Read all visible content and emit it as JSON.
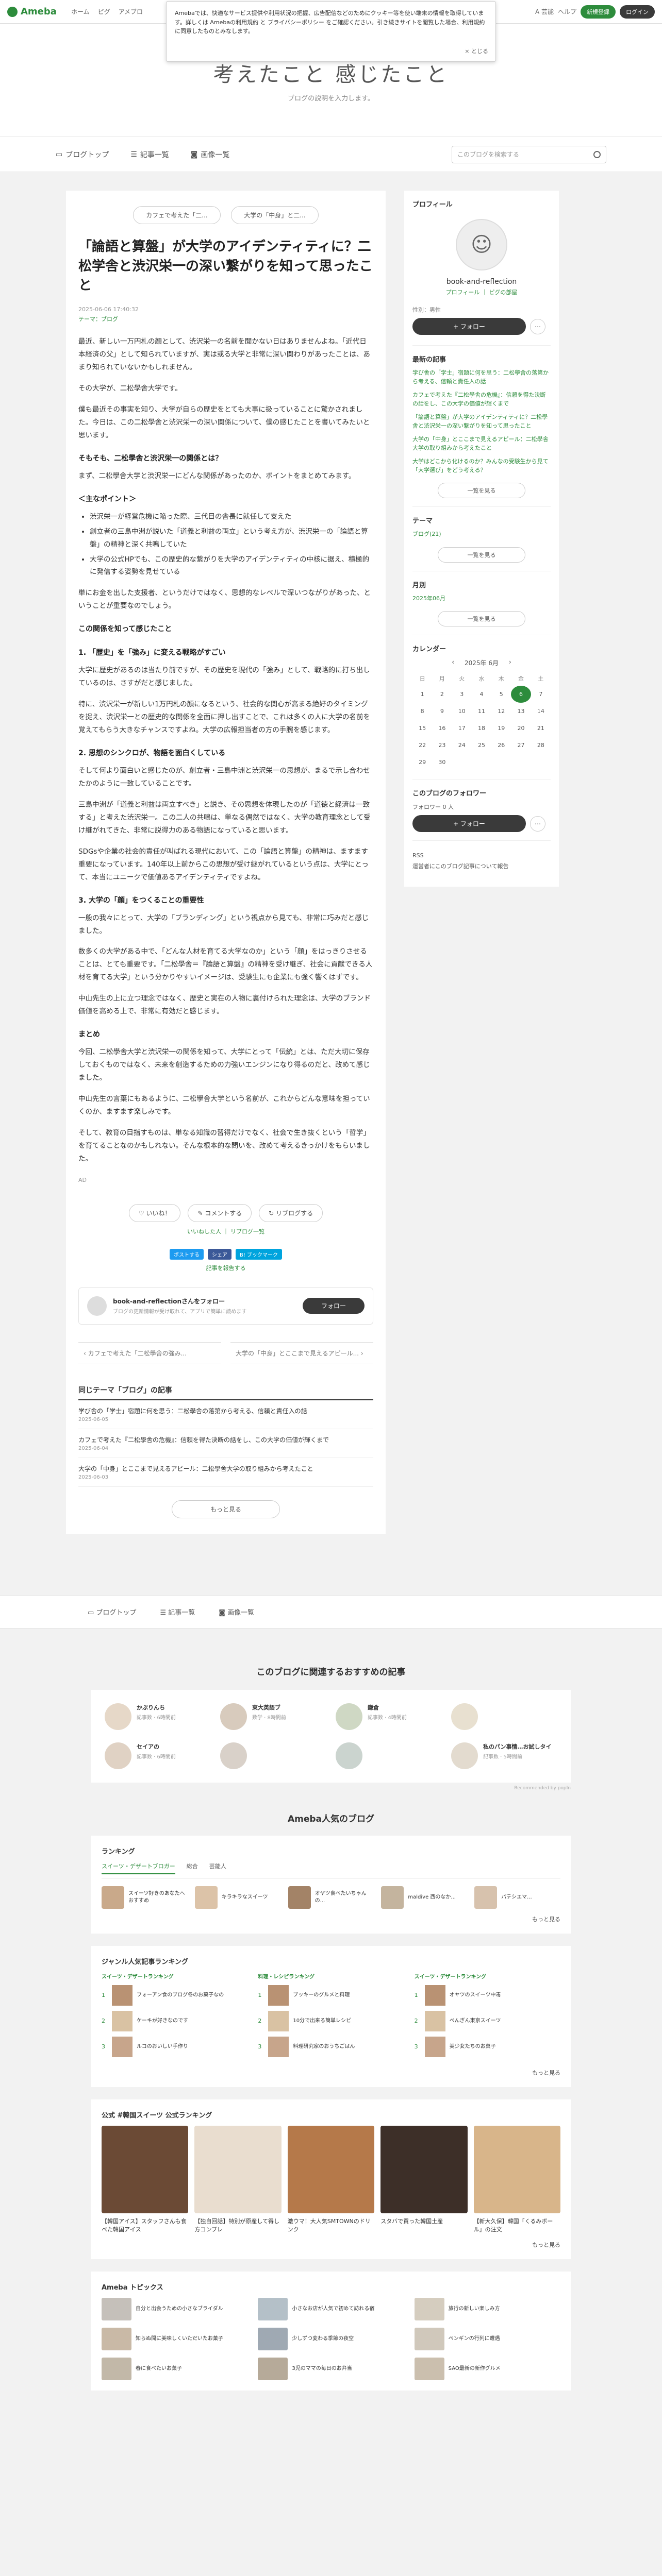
{
  "topnav": {
    "logo": "Ameba",
    "links": [
      "ホーム",
      "ピグ",
      "アメブロ"
    ],
    "right": [
      "A 芸能",
      "ヘルプ"
    ],
    "signup": "新規登録",
    "login": "ログイン"
  },
  "cookie": {
    "text": "Amebaでは、快適なサービス提供や利用状況の把握、広告配信などのためにクッキー等を使い端末の情報を取得しています。詳しくは Amebaの利用規約 と プライバシーポリシー をご確認ください。引き続きサイトを閲覧した場合、利用規約に同意したものとみなします。",
    "close": "× とじる"
  },
  "blog": {
    "title": "考えたこと  感じたこと",
    "description": "ブログの説明を入力します。"
  },
  "subnav": {
    "tabs": [
      "ブログトップ",
      "記事一覧",
      "画像一覧"
    ],
    "search_placeholder": "このブログを検索する"
  },
  "article": {
    "prev_pill": "カフェで考えた「二...",
    "next_pill": "大学の「中身」と二...",
    "title": "「論語と算盤」が大学のアイデンティティに？二松学舎と渋沢栄一の深い繋がりを知って思ったこと",
    "date": "2025-06-06 17:40:32",
    "theme": "テーマ：ブログ",
    "p1": "最近、新しい一万円札の顔として、渋沢栄一の名前を聞かない日はありませんよね。「近代日本経済の父」として知られていますが、実は或る大学と非常に深い関わりがあったことは、あまり知られていないかもしれません。",
    "p2": "その大学が、二松學舎大学です。",
    "p3": "僕も最近その事実を知り、大学が自らの歴史をとても大事に扱っていることに驚かされました。今日は、この二松學舎と渋沢栄一の深い関係について、僕の感じたことを書いてみたいと思います。",
    "h1": "そもそも、二松學舎と渋沢栄一の関係とは？",
    "p4": "まず、二松學舎大学と渋沢栄一にどんな関係があったのか、ポイントをまとめてみます。",
    "h2": "＜主なポイント＞",
    "points": [
      "渋沢栄一が経営危機に陥った際、三代目の舎長に就任して支えた",
      "創立者の三島中洲が説いた「道義と利益の両立」という考え方が、渋沢栄一の「論語と算盤」の精神と深く共鳴していた",
      "大学の公式HPでも、この歴史的な繋がりを大学のアイデンティティの中核に据え、積極的に発信する姿勢を見せている"
    ],
    "p5": "単にお金を出した支援者、というだけではなく、思想的なレベルで深いつながりがあった、ということが重要なのでしょう。",
    "h3": "この関係を知って感じたこと",
    "h4": "1. 「歴史」を「強み」に変える戦略がすごい",
    "p6": "大学に歴史があるのは当たり前ですが、その歴史を現代の「強み」として、戦略的に打ち出しているのは、さすがだと感じました。",
    "p7": "特に、渋沢栄一が新しい1万円札の顔になるという、社会的な関心が高まる絶好のタイミングを捉え、渋沢栄一との歴史的な関係を全面に押し出すことで、これは多くの人に大学の名前を覚えてもらう大きなチャンスですよね。大学の広報担当者の方の手腕を感じます。",
    "h5": "2. 思想のシンクロが、物語を面白くしている",
    "p8": "そして何より面白いと感じたのが、創立者・三島中洲と渋沢栄一の思想が、まるで示し合わせたかのように一致していることです。",
    "p9": "三島中洲が「道義と利益は両立すべき」と説き、その思想を体現したのが「道徳と経済は一致する」と考えた渋沢栄一。この二人の共鳴は、単なる偶然ではなく、大学の教育理念として受け継がれてきた、非常に説得力のある物語になっていると思います。",
    "p10": "SDGsや企業の社会的責任が叫ばれる現代において、この「論語と算盤」の精神は、ますます重要になっています。140年以上前からこの思想が受け継がれているという点は、大学にとって、本当にユニークで価値あるアイデンティティですよね。",
    "h6": "3. 大学の「顔」をつくることの重要性",
    "p11": "一般の我々にとって、大学の「ブランディング」という視点から見ても、非常に巧みだと感じました。",
    "p12": "数多くの大学がある中で、「どんな人材を育てる大学なのか」という「顔」をはっきりさせることは、とても重要です。「二松學舎＝『論語と算盤』の精神を受け継ぎ、社会に貢献できる人材を育てる大学」という分かりやすいイメージは、受験生にも企業にも強く響くはずです。",
    "p13": "中山先生の上に立つ理念ではなく、歴史と実在の人物に裏付けられた理念は、大学のブランド価値を高める上で、非常に有効だと感じます。",
    "h7": "まとめ",
    "p14": "今回、二松學舎大学と渋沢栄一の関係を知って、大学にとって「伝統」とは、ただ大切に保存しておくものではなく、未来を創造するための力強いエンジンになり得るのだと、改めて感じました。",
    "p15": "中山先生の言葉にもあるように、二松學舎大学という名前が、これからどんな意味を担っていくのか、ますます楽しみです。",
    "p16": "そして、教育の目指すものは、単なる知識の習得だけでなく、社会で生き抜くという「哲学」を育てることなのかもしれない。そんな根本的な問いを、改めて考えるきっかけをもらいました。",
    "author_line": "AD"
  },
  "actions": {
    "like": "いいね！",
    "comment": "コメントする",
    "reblog": "リブログする",
    "like_users": "いいねした人 ｜ リブログ一覧",
    "share": [
      "ポストする",
      "シェア",
      "B! ブックマーク"
    ],
    "report": "記事を報告する"
  },
  "followcard": {
    "name": "book-and-reflectionさんをフォロー",
    "sub": "ブログの更新情報が受け取れて、アプリで簡単に読めます",
    "button": "フォロー"
  },
  "prevnext": {
    "prev": "カフェで考えた「二松學舎の強み...",
    "next": "大学の「中身」とここまで見えるアピール..."
  },
  "related": {
    "title": "同じテーマ「ブログ」の記事",
    "items": [
      {
        "t": "学び舎の「学士」宿題に何を思う：二松學舎の落第から考える、信頼と責任入の話",
        "d": "2025-06-05"
      },
      {
        "t": "カフェで考えた『二松學舎の危機』：信頼を得た決断の話をし、この大学の価値が輝くまで",
        "d": "2025-06-04"
      },
      {
        "t": "大学の「中身」とここまで見えるアピール：二松學舎大学の取り組みから考えたこと",
        "d": "2025-06-03"
      }
    ],
    "more": "もっと見る"
  },
  "sidebar": {
    "profile_h": "プロフィール",
    "name": "book-and-reflection",
    "links": "プロフィール ｜ ピグの部屋",
    "status": "性別：男性",
    "follow": "+ フォロー",
    "recent_h": "最新の記事",
    "recent": [
      "学び舎の「学士」宿題に何を思う：二松學舎の落第から考える、信頼と責任入の話",
      "カフェで考えた『二松學舎の危機』：信頼を得た決断の話をし、この大学の価値が輝くまで",
      "「論語と算盤」が大学のアイデンティティに？二松學舎と渋沢栄一の深い繋がりを知って思ったこと",
      "大学の「中身」とここまで見えるアピール：二松學舎大学の取り組みから考えたこと",
      "大学はどこから化けるのか？みんなの受験生から見て「大学選び」をどう考える？"
    ],
    "recent_btn": "一覧を見る",
    "theme_h": "テーマ",
    "theme_item": "ブログ(21)",
    "theme_btn": "一覧を見る",
    "month_h": "月別",
    "month_item": "2025年06月",
    "month_btn": "一覧を見る",
    "cal_h": "カレンダー",
    "cal_month": "2025年 6月",
    "cal_days": [
      "日",
      "月",
      "火",
      "水",
      "木",
      "金",
      "土"
    ],
    "followers_h": "このブログのフォロワー",
    "followers": "フォロワー 0 人",
    "follow2": "+ フォロー",
    "rss": "RSS",
    "report": "運営者にこのブログ記事について報告"
  },
  "recommend": {
    "title": "このブログに関連するおすすめの記事",
    "items": [
      {
        "t": "かぶりんち",
        "s": "記事数 · 6時間前"
      },
      {
        "t": "東大英語ブ",
        "s": "数学 · 8時間前"
      },
      {
        "t": "鎌倉",
        "s": "記事数 · 4時間前"
      },
      {
        "t": "",
        "s": ""
      },
      {
        "t": "セイアの",
        "s": "記事数 · 6時間前"
      },
      {
        "t": "",
        "s": ""
      },
      {
        "t": "",
        "s": ""
      },
      {
        "t": "私のパン事情…お試しタイ",
        "s": "記事数 · 5時間前"
      }
    ],
    "powered": "Recommended by popIn"
  },
  "popular": {
    "title": "Ameba人気のブログ",
    "ranking_h": "ランキング",
    "ranking_tabs": [
      "スイーツ・デザートブロガー",
      "総合",
      "芸能人"
    ],
    "ranking": [
      "スイーツ好きのあなたへおすすめ",
      "キラキラなスイーツ",
      "オヤツ食べたいちゃんの...",
      "maldive 西のなか...",
      "パテシエマ..."
    ],
    "more": "もっと見る",
    "genre_h": "ジャンル人気記事ランキング",
    "genre_cols": [
      {
        "h": "スイーツ・デザートランキング",
        "items": [
          "フォーアン食のブログ冬のお菓子なの",
          "ケーキが好きなのです",
          "ルコのおいしい手作り"
        ]
      },
      {
        "h": "料理・レシピランキング",
        "items": [
          "ブッキーのグルメと料理",
          "10分で出来る簡単レシピ",
          "料理研究家のおうちごはん"
        ]
      },
      {
        "h": "スイーツ・デザートランキング",
        "items": [
          "オヤツのスイーツ中毒",
          "ぺんぎん東京スイーツ",
          "美少女たちのお菓子"
        ]
      }
    ],
    "sweets_h": "公式 #韓国スイーツ 公式ランキング",
    "sweets": [
      "【韓国アイス】スタッフさんも食べた韓国アイス",
      "【独自回話】特別が原産して得し方コンプレ",
      "激ウマ！大人気SMTOWNのドリンク",
      "スタバで買った韓国土産",
      "【新大久保】韓国「くるみボール」の注文"
    ],
    "topics_h": "Ameba トピックス",
    "topics": [
      "自分と出会うための小さなブライダル",
      "小さなお店が人気で初めて訪れる宿",
      "旅行の新しい楽しみ方",
      "知らぬ間に美味しくいただいたお菓子",
      "少しずつ変わる季節の夜空",
      "ペンギンの行列に遭遇",
      "春に食べたいお菓子",
      "3児のママの毎日のお弁当",
      "SAO最新の新作グルメ"
    ]
  }
}
